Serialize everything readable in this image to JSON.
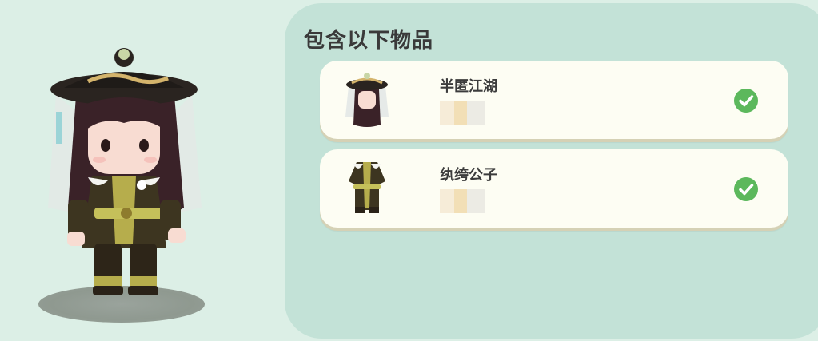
{
  "panel": {
    "title": "包含以下物品",
    "items": [
      {
        "name": "半匿江湖",
        "icon": "hat-veil-icon",
        "owned": true
      },
      {
        "name": "纨绔公子",
        "icon": "outfit-robe-icon",
        "owned": true
      }
    ]
  },
  "colors": {
    "background": "#dcefe6",
    "panel": "#c3e2d7",
    "card": "#fdfdf3",
    "check": "#5cb85c"
  }
}
